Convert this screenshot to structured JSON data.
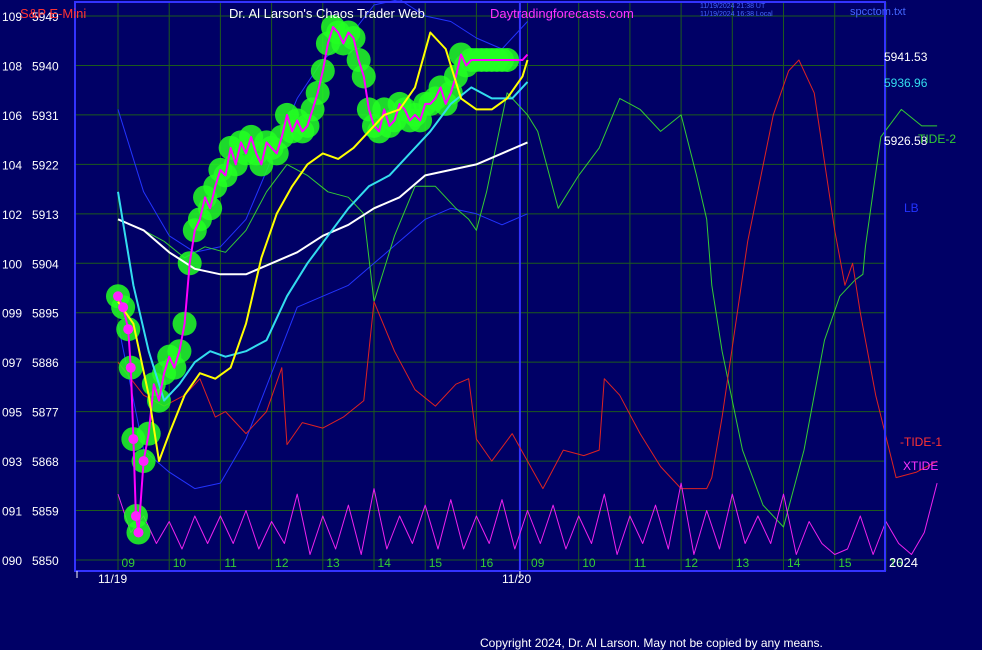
{
  "header": {
    "symbol": "S&P E-Mini",
    "title": "Dr. Al Larson's Chaos Trader Web",
    "site": "Daytradingforecasts.com",
    "timestamp_lines": [
      "11/19/2024 21:38 UT",
      "11/19/2024 16:38 Local"
    ],
    "file": "spcctom.txt"
  },
  "footer": {
    "copyright": "Copyright 2024, Dr. Al Larson. May not be copied by any means."
  },
  "colors": {
    "background": "#000066",
    "plot_border": "#3333ff",
    "grid": "#1d5a1d",
    "price": "#ff00ff",
    "avg_fast": "#ffff00",
    "avg_mid": "#33ddee",
    "avg_slow": "#ffffff",
    "band": "#2233ff",
    "tide1": "#dd2222",
    "tide2": "#33cc33",
    "xtide": "#ee22ee",
    "highlight": "#22ff22",
    "marker": "#ff22ff"
  },
  "chart_data": {
    "type": "line",
    "title": "S&P E-Mini",
    "y_axis": {
      "labels": [
        {
          "left": "109",
          "right": "5949"
        },
        {
          "left": "108",
          "right": "5940"
        },
        {
          "left": "106",
          "right": "5931"
        },
        {
          "left": "104",
          "right": "5922"
        },
        {
          "left": "102",
          "right": "5913"
        },
        {
          "left": "100",
          "right": "5904"
        },
        {
          "left": "099",
          "right": "5895"
        },
        {
          "left": "097",
          "right": "5886"
        },
        {
          "left": "095",
          "right": "5877"
        },
        {
          "left": "093",
          "right": "5868"
        },
        {
          "left": "091",
          "right": "5859"
        },
        {
          "left": "090",
          "right": "5850"
        }
      ],
      "range": [
        5850,
        5949
      ]
    },
    "x_axis": {
      "hour_labels": [
        "09",
        "10",
        "11",
        "12",
        "13",
        "14",
        "15",
        "16",
        "09",
        "10",
        "11",
        "12",
        "13",
        "14",
        "15",
        "16"
      ],
      "date_labels": [
        "11/19",
        "11/20"
      ],
      "year": "2024"
    },
    "value_labels": [
      "5941.53",
      "5936.96",
      "5926.58"
    ],
    "legend": [
      "TIDE-2",
      "LB",
      "-TIDE-1",
      "XTIDE"
    ],
    "series": [
      {
        "name": "S&P E-Mini",
        "role": "price",
        "x": [
          0,
          0.1,
          0.2,
          0.25,
          0.3,
          0.35,
          0.4,
          0.5,
          0.6,
          0.7,
          0.8,
          0.9,
          1.0,
          1.1,
          1.2,
          1.3,
          1.4,
          1.5,
          1.6,
          1.7,
          1.8,
          1.9,
          2.0,
          2.1,
          2.2,
          2.3,
          2.4,
          2.5,
          2.6,
          2.7,
          2.8,
          2.9,
          3.0,
          3.1,
          3.2,
          3.3,
          3.4,
          3.5,
          3.6,
          3.7,
          3.8,
          3.9,
          4.0,
          4.1,
          4.2,
          4.3,
          4.4,
          4.5,
          4.6,
          4.7,
          4.8,
          4.9,
          5.0,
          5.1,
          5.2,
          5.3,
          5.4,
          5.5,
          5.6,
          5.7,
          5.8,
          5.9,
          6.0,
          6.1,
          6.2,
          6.3,
          6.4,
          6.5,
          6.6,
          6.7,
          6.8,
          6.9,
          7.0,
          7.1,
          7.2,
          7.3,
          7.4,
          7.5,
          7.6,
          7.7,
          7.8,
          7.9,
          8.0
        ],
        "y": [
          5898,
          5896,
          5892,
          5885,
          5872,
          5858,
          5855,
          5868,
          5873,
          5882,
          5879,
          5884,
          5887,
          5885,
          5888,
          5893,
          5904,
          5910,
          5912,
          5916,
          5914,
          5918,
          5921,
          5920,
          5925,
          5922,
          5926,
          5924,
          5927,
          5924,
          5922,
          5926,
          5925,
          5924,
          5927,
          5931,
          5928,
          5930,
          5928,
          5929,
          5932,
          5935,
          5939,
          5944,
          5947,
          5946,
          5944,
          5946,
          5945,
          5941,
          5938,
          5932,
          5929,
          5928,
          5932,
          5929,
          5930,
          5933,
          5932,
          5930,
          5931,
          5930,
          5933,
          5933,
          5934,
          5936,
          5933,
          5935,
          5938,
          5942,
          5940,
          5941,
          5941,
          5941,
          5941,
          5941,
          5941,
          5941,
          5941,
          5941,
          5941,
          5941,
          5942
        ]
      },
      {
        "name": "",
        "role": "avg_fast",
        "x": [
          0,
          0.3,
          0.6,
          0.8,
          1.0,
          1.3,
          1.6,
          1.9,
          2.2,
          2.5,
          2.8,
          3.1,
          3.4,
          3.7,
          4.0,
          4.3,
          4.6,
          4.9,
          5.2,
          5.5,
          5.8,
          6.1,
          6.4,
          6.7,
          7.0,
          7.3,
          7.6,
          7.9,
          8.0
        ],
        "y": [
          5897,
          5893,
          5880,
          5868,
          5873,
          5880,
          5884,
          5883,
          5885,
          5893,
          5905,
          5913,
          5918,
          5922,
          5924,
          5923,
          5925,
          5928,
          5931,
          5932,
          5936,
          5946,
          5943,
          5934,
          5932,
          5932,
          5934,
          5938,
          5941
        ]
      },
      {
        "name": "",
        "role": "avg_mid",
        "x": [
          0,
          0.3,
          0.6,
          0.9,
          1.2,
          1.5,
          1.8,
          2.1,
          2.5,
          2.9,
          3.3,
          3.7,
          4.1,
          4.5,
          4.9,
          5.3,
          5.7,
          6.1,
          6.5,
          6.9,
          7.3,
          7.7,
          8.0
        ],
        "y": [
          5917,
          5900,
          5888,
          5879,
          5882,
          5886,
          5888,
          5887,
          5888,
          5890,
          5898,
          5904,
          5909,
          5914,
          5918,
          5920,
          5924,
          5928,
          5933,
          5936,
          5934,
          5934,
          5937
        ]
      },
      {
        "name": "",
        "role": "avg_slow",
        "x": [
          0,
          0.5,
          1.0,
          1.5,
          2.0,
          2.5,
          3.0,
          3.5,
          4.0,
          4.5,
          5.0,
          5.5,
          6.0,
          6.5,
          7.0,
          7.5,
          8.0
        ],
        "y": [
          5912,
          5910,
          5906,
          5903,
          5902,
          5902,
          5904,
          5906,
          5909,
          5911,
          5914,
          5916,
          5920,
          5921,
          5922,
          5924,
          5926
        ]
      },
      {
        "name": "",
        "role": "band_upper",
        "x": [
          0,
          0.5,
          1.0,
          1.5,
          2.0,
          2.5,
          3.0,
          3.5,
          4.0,
          4.5,
          5.0,
          5.5,
          6.0,
          6.5,
          7.0,
          7.5,
          8.0
        ],
        "y": [
          5932,
          5917,
          5909,
          5906,
          5907,
          5912,
          5923,
          5934,
          5941,
          5945,
          5951,
          5952,
          5949,
          5948,
          5945,
          5943,
          5948
        ]
      },
      {
        "name": "",
        "role": "band_lower",
        "x": [
          0,
          0.5,
          1.0,
          1.5,
          2.0,
          2.5,
          3.0,
          3.5,
          4.0,
          4.5,
          5.0,
          5.5,
          6.0,
          6.5,
          7.0,
          7.5,
          8.0
        ],
        "y": [
          5893,
          5870,
          5866,
          5863,
          5864,
          5872,
          5884,
          5896,
          5898,
          5900,
          5904,
          5908,
          5912,
          5914,
          5913,
          5911,
          5913
        ]
      },
      {
        "name": "TIDE-2",
        "role": "tide2",
        "x": [
          0,
          0.5,
          0.9,
          1.3,
          1.7,
          2.1,
          2.5,
          2.9,
          3.3,
          3.7,
          4.1,
          4.5,
          4.8,
          5.0,
          5.4,
          5.8,
          6.2,
          6.6,
          6.85,
          7.0,
          7.2,
          7.6,
          8.0,
          8.2,
          8.6,
          9.0,
          9.4,
          9.8,
          10.2,
          10.6,
          11.0,
          11.3,
          11.5,
          11.6,
          11.8,
          12.2,
          12.6,
          13.0,
          13.4,
          13.8,
          14.1,
          14.4,
          14.55,
          14.6,
          14.9,
          15.3,
          15.7,
          16.0
        ],
        "y": [
          5912,
          5910,
          5908,
          5905,
          5907,
          5906,
          5910,
          5917,
          5922,
          5920,
          5917,
          5916,
          5913,
          5897,
          5909,
          5918,
          5918,
          5914,
          5912,
          5910,
          5917,
          5935,
          5931,
          5928,
          5914,
          5920,
          5925,
          5934,
          5932,
          5928,
          5931,
          5920,
          5912,
          5900,
          5888,
          5870,
          5860,
          5856,
          5870,
          5890,
          5898,
          5901,
          5902,
          5907,
          5927,
          5932,
          5929,
          5929
        ]
      },
      {
        "name": "-TIDE-1",
        "role": "tide1",
        "x": [
          0,
          0.5,
          0.9,
          1.3,
          1.6,
          1.9,
          2.1,
          2.5,
          2.9,
          3.2,
          3.3,
          3.6,
          4.0,
          4.4,
          4.8,
          5.0,
          5.4,
          5.8,
          6.2,
          6.6,
          6.85,
          7.0,
          7.3,
          7.7,
          8.0,
          8.3,
          8.7,
          9.1,
          9.4,
          9.5,
          9.8,
          10.2,
          10.6,
          11.0,
          11.3,
          11.5,
          11.6,
          11.8,
          12.3,
          12.8,
          13.1,
          13.3,
          13.6,
          14.0,
          14.2,
          14.35,
          14.5,
          14.8,
          15.2,
          15.6,
          16.0
        ],
        "y": [
          5886,
          5880,
          5878,
          5880,
          5883,
          5876,
          5877,
          5873,
          5877,
          5885,
          5871,
          5875,
          5874,
          5876,
          5879,
          5897,
          5888,
          5881,
          5878,
          5882,
          5883,
          5872,
          5868,
          5873,
          5868,
          5863,
          5870,
          5869,
          5870,
          5883,
          5880,
          5873,
          5867,
          5863,
          5863,
          5863,
          5865,
          5876,
          5908,
          5931,
          5939,
          5941,
          5935,
          5910,
          5900,
          5904,
          5895,
          5880,
          5865,
          5866,
          5868
        ]
      },
      {
        "name": "XTIDE",
        "role": "xtide",
        "x": [
          0,
          0.25,
          0.5,
          0.75,
          1.0,
          1.25,
          1.5,
          1.75,
          2.0,
          2.25,
          2.5,
          2.75,
          3.0,
          3.25,
          3.5,
          3.75,
          4.0,
          4.25,
          4.5,
          4.75,
          5.0,
          5.25,
          5.5,
          5.75,
          6.0,
          6.25,
          6.5,
          6.75,
          7.0,
          7.25,
          7.5,
          7.75,
          8.0,
          8.25,
          8.5,
          8.75,
          9.0,
          9.25,
          9.5,
          9.75,
          10.0,
          10.25,
          10.5,
          10.75,
          11.0,
          11.25,
          11.5,
          11.75,
          12.0,
          12.25,
          12.5,
          12.75,
          13.0,
          13.25,
          13.5,
          13.75,
          14.0,
          14.25,
          14.5,
          14.75,
          15.0,
          15.25,
          15.5,
          15.75,
          16.0
        ],
        "y": [
          5862,
          5855,
          5858,
          5853,
          5857,
          5852,
          5858,
          5853,
          5858,
          5853,
          5859,
          5852,
          5857,
          5853,
          5862,
          5851,
          5858,
          5852,
          5860,
          5851,
          5863,
          5852,
          5858,
          5853,
          5860,
          5852,
          5861,
          5852,
          5858,
          5853,
          5861,
          5852,
          5859,
          5853,
          5860,
          5852,
          5858,
          5853,
          5862,
          5851,
          5858,
          5853,
          5860,
          5852,
          5864,
          5851,
          5859,
          5852,
          5862,
          5853,
          5858,
          5853,
          5862,
          5851,
          5857,
          5853,
          5851,
          5852,
          5858,
          5851,
          5857,
          5853,
          5851,
          5855,
          5864
        ]
      }
    ]
  }
}
